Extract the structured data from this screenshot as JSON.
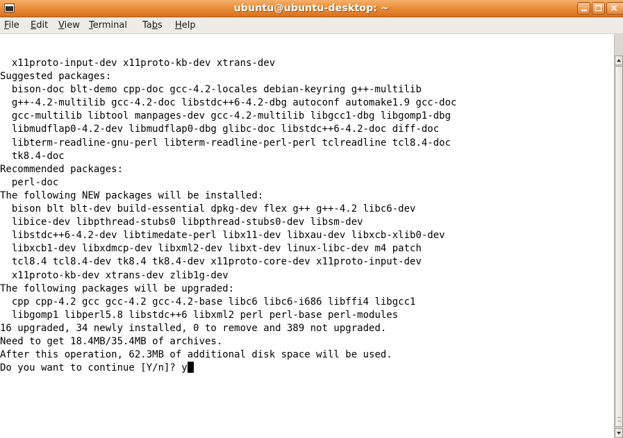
{
  "window": {
    "title": "ubuntu@ubuntu-desktop: ~",
    "icon": "terminal-icon",
    "controls": [
      "minimize-icon",
      "maximize-icon",
      "close-icon"
    ],
    "close_glyph": "×",
    "accent_color": "#e8883a"
  },
  "menubar": {
    "items": [
      {
        "accel": "F",
        "rest": "ile"
      },
      {
        "accel": "E",
        "rest": "dit"
      },
      {
        "accel": "V",
        "rest": "iew"
      },
      {
        "accel": "T",
        "rest": "erminal"
      },
      {
        "pre": "Ta",
        "accel": "b",
        "rest": "s"
      },
      {
        "accel": "H",
        "rest": "elp"
      }
    ]
  },
  "terminal": {
    "lines": [
      "  x11proto-input-dev x11proto-kb-dev xtrans-dev",
      "Suggested packages:",
      "  bison-doc blt-demo cpp-doc gcc-4.2-locales debian-keyring g++-multilib",
      "  g++-4.2-multilib gcc-4.2-doc libstdc++6-4.2-dbg autoconf automake1.9 gcc-doc",
      "  gcc-multilib libtool manpages-dev gcc-4.2-multilib libgcc1-dbg libgomp1-dbg",
      "  libmudflap0-4.2-dev libmudflap0-dbg glibc-doc libstdc++6-4.2-doc diff-doc",
      "  libterm-readline-gnu-perl libterm-readline-perl-perl tclreadline tcl8.4-doc",
      "  tk8.4-doc",
      "Recommended packages:",
      "  perl-doc",
      "The following NEW packages will be installed:",
      "  bison blt blt-dev build-essential dpkg-dev flex g++ g++-4.2 libc6-dev",
      "  libice-dev libpthread-stubs0 libpthread-stubs0-dev libsm-dev",
      "  libstdc++6-4.2-dev libtimedate-perl libx11-dev libxau-dev libxcb-xlib0-dev",
      "  libxcb1-dev libxdmcp-dev libxml2-dev libxt-dev linux-libc-dev m4 patch",
      "  tcl8.4 tcl8.4-dev tk8.4 tk8.4-dev x11proto-core-dev x11proto-input-dev",
      "  x11proto-kb-dev xtrans-dev zlib1g-dev",
      "The following packages will be upgraded:",
      "  cpp cpp-4.2 gcc gcc-4.2 gcc-4.2-base libc6 libc6-i686 libffi4 libgcc1",
      "  libgomp1 libperl5.8 libstdc++6 libxml2 perl perl-base perl-modules",
      "16 upgraded, 34 newly installed, 0 to remove and 389 not upgraded.",
      "Need to get 18.4MB/35.4MB of archives.",
      "After this operation, 62.3MB of additional disk space will be used."
    ],
    "prompt": "Do you want to continue [Y/n]? ",
    "input": "y"
  }
}
